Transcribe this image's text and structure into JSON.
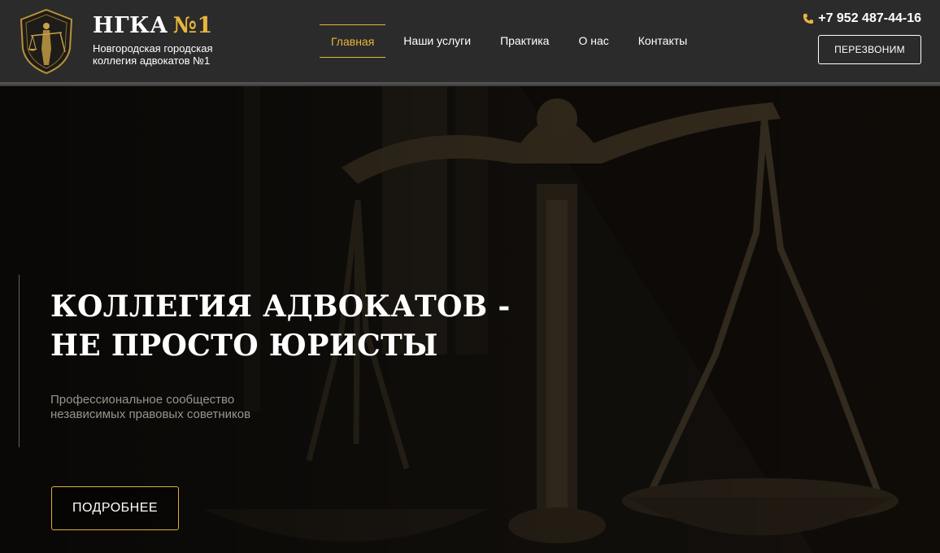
{
  "brand": {
    "abbr": "НГКА",
    "number": "№1",
    "subtitle": "Новгородская городская коллегия адвокатов №1",
    "accent_color": "#e8b53c"
  },
  "nav": {
    "items": [
      {
        "label": "Главная",
        "active": true
      },
      {
        "label": "Наши услуги",
        "active": false
      },
      {
        "label": "Практика",
        "active": false
      },
      {
        "label": "О нас",
        "active": false
      },
      {
        "label": "Контакты",
        "active": false
      }
    ]
  },
  "contact": {
    "phone": "+7 952 487-44-16",
    "phone_icon": "phone-icon",
    "callback_label": "ПЕРЕЗВОНИМ"
  },
  "hero": {
    "title_line1": "КОЛЛЕГИЯ АДВОКАТОВ -",
    "title_line2": "НЕ ПРОСТО ЮРИСТЫ",
    "subtitle": "Профессиональное сообщество независимых правовых советников",
    "button_label": "ПОДРОБНЕЕ",
    "background": "scales-of-justice-image"
  }
}
